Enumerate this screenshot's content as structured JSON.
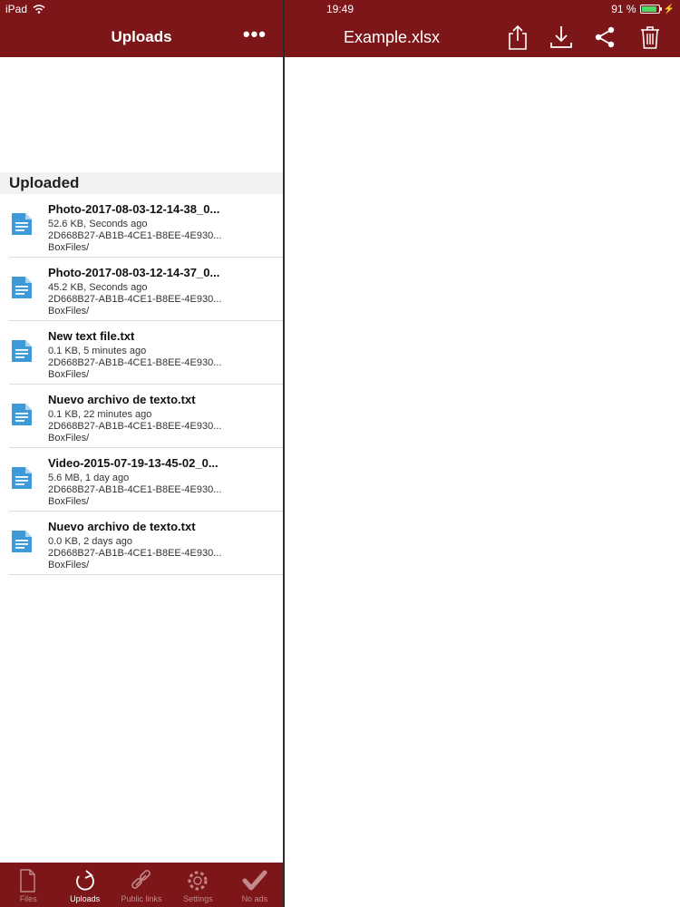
{
  "status": {
    "device": "iPad",
    "time": "19:49",
    "battery": "91 %",
    "battery_level": 0.91
  },
  "left_nav": {
    "title": "Uploads",
    "more": "•••"
  },
  "right_nav": {
    "title": "Example.xlsx"
  },
  "section": {
    "title": "Uploaded"
  },
  "files": [
    {
      "name": "Photo-2017-08-03-12-14-38_0...",
      "size_time": "52.6 KB, Seconds ago",
      "id": "2D668B27-AB1B-4CE1-B8EE-4E930...",
      "folder": "BoxFiles/"
    },
    {
      "name": "Photo-2017-08-03-12-14-37_0...",
      "size_time": "45.2 KB, Seconds ago",
      "id": "2D668B27-AB1B-4CE1-B8EE-4E930...",
      "folder": "BoxFiles/"
    },
    {
      "name": "New text file.txt",
      "size_time": "0.1 KB, 5 minutes ago",
      "id": "2D668B27-AB1B-4CE1-B8EE-4E930...",
      "folder": "BoxFiles/"
    },
    {
      "name": "Nuevo archivo de texto.txt",
      "size_time": "0.1 KB, 22 minutes ago",
      "id": "2D668B27-AB1B-4CE1-B8EE-4E930...",
      "folder": "BoxFiles/"
    },
    {
      "name": "Video-2015-07-19-13-45-02_0...",
      "size_time": "5.6 MB, 1 day ago",
      "id": "2D668B27-AB1B-4CE1-B8EE-4E930...",
      "folder": "BoxFiles/"
    },
    {
      "name": "Nuevo archivo de texto.txt",
      "size_time": "0.0 KB, 2 days ago",
      "id": "2D668B27-AB1B-4CE1-B8EE-4E930...",
      "folder": "BoxFiles/"
    }
  ],
  "tabs": [
    {
      "label": "Files",
      "icon": "files-icon"
    },
    {
      "label": "Uploads",
      "icon": "uploads-icon",
      "active": true
    },
    {
      "label": "Public links",
      "icon": "link-icon"
    },
    {
      "label": "Settings",
      "icon": "gear-icon"
    },
    {
      "label": "No ads",
      "icon": "checkmark-icon"
    }
  ],
  "colors": {
    "bar": "#7d1619",
    "doc_icon": "#3d9ad8",
    "tab_inactive": "#c28a8c",
    "tab_active": "#ffffff"
  }
}
